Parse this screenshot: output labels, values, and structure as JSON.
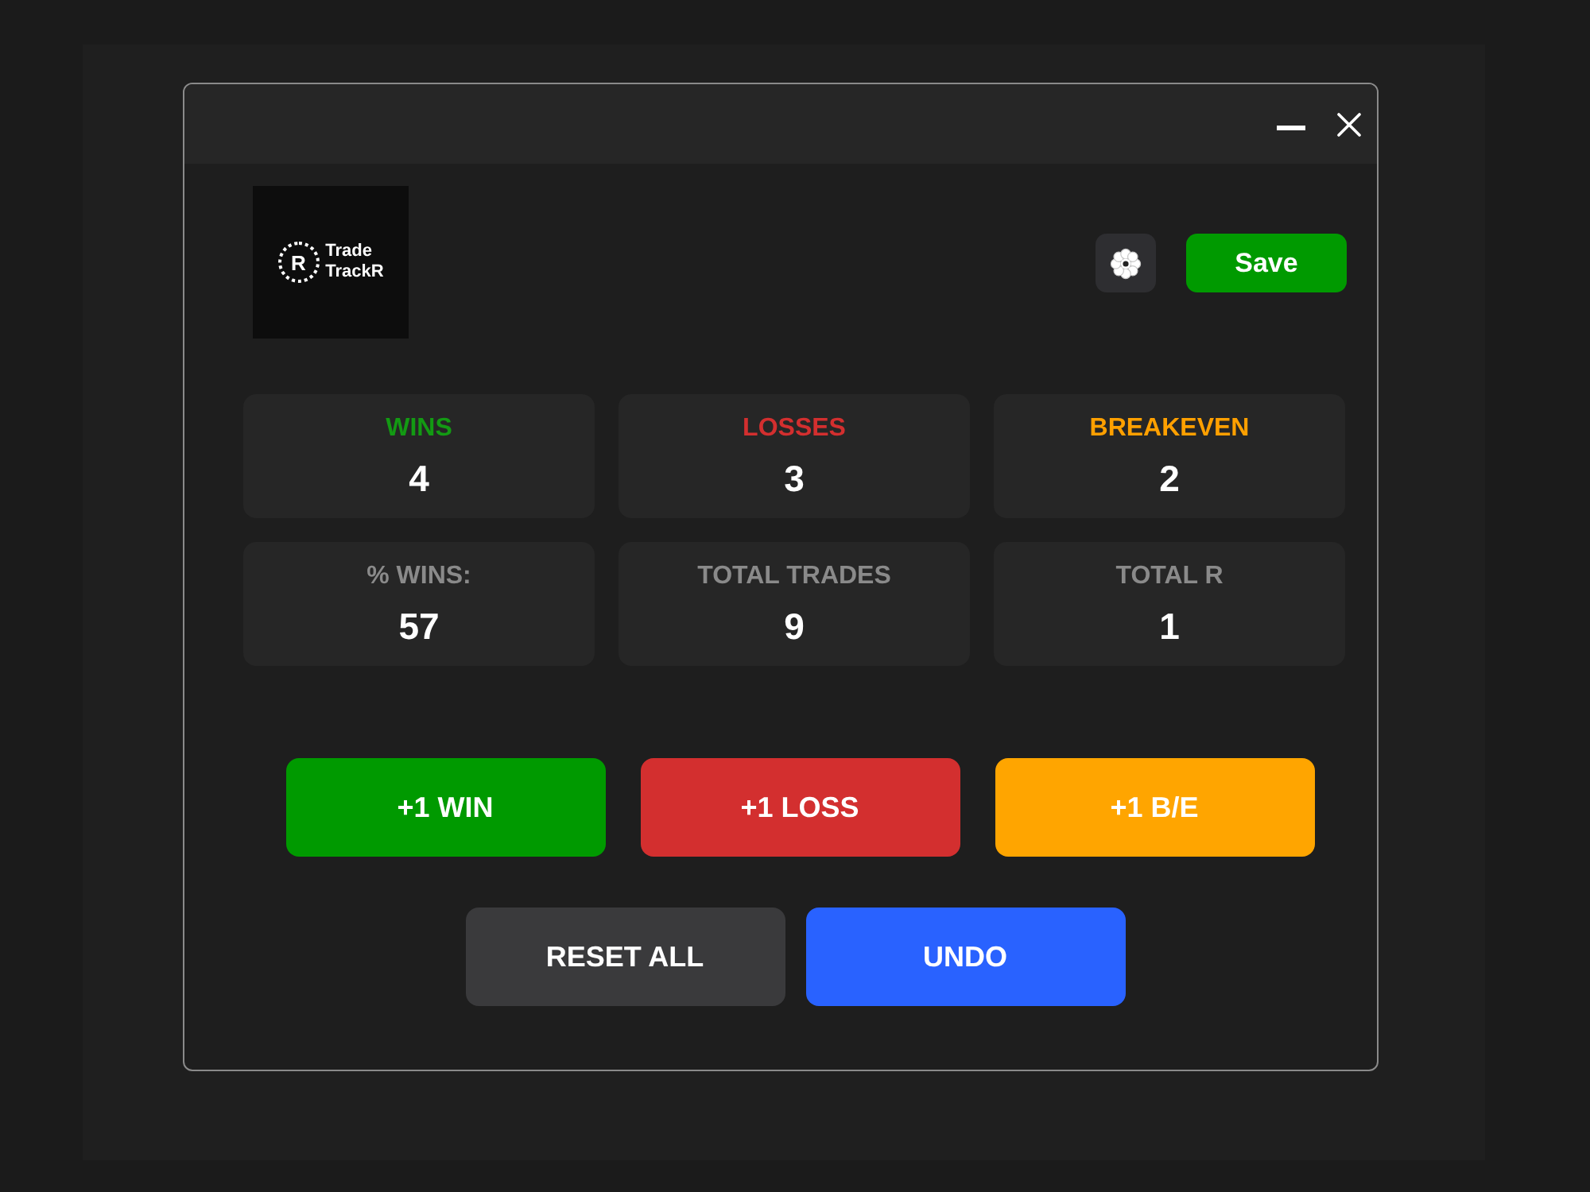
{
  "logo": {
    "mark": "R",
    "lines": [
      "Trade",
      "TrackR"
    ]
  },
  "header": {
    "save_label": "Save"
  },
  "stats": [
    {
      "label": "WINS",
      "value": "4",
      "color": "#139a13"
    },
    {
      "label": "LOSSES",
      "value": "3",
      "color": "#d32f2f"
    },
    {
      "label": "BREAKEVEN",
      "value": "2",
      "color": "#ffa000"
    },
    {
      "label": "% WINS:",
      "value": "57",
      "color": "#8a8a8a"
    },
    {
      "label": "TOTAL TRADES",
      "value": "9",
      "color": "#8a8a8a"
    },
    {
      "label": "TOTAL R",
      "value": "1",
      "color": "#8a8a8a"
    }
  ],
  "actions": [
    {
      "label": "+1 WIN",
      "color": "#009a00"
    },
    {
      "label": "+1 LOSS",
      "color": "#d32f2f"
    },
    {
      "label": "+1 B/E",
      "color": "#ffa500"
    }
  ],
  "controls": [
    {
      "label": "RESET ALL",
      "color": "#3a3a3c"
    },
    {
      "label": "UNDO",
      "color": "#2962ff"
    }
  ]
}
